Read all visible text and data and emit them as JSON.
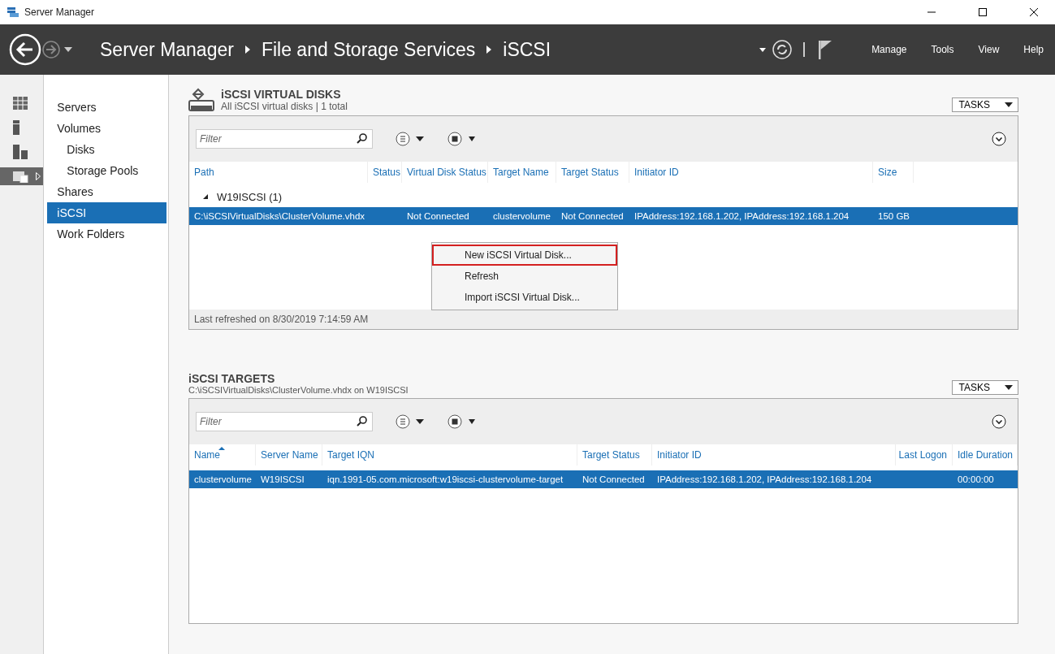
{
  "window": {
    "title": "Server Manager"
  },
  "breadcrumb": [
    "Server Manager",
    "File and Storage Services",
    "iSCSI"
  ],
  "header_menu": [
    "Manage",
    "Tools",
    "View",
    "Help"
  ],
  "rail": [
    {
      "kind": "dashboard",
      "selected": false
    },
    {
      "kind": "server",
      "selected": false
    },
    {
      "kind": "servers",
      "selected": false
    },
    {
      "kind": "storage",
      "selected": true
    }
  ],
  "nav": [
    {
      "label": "Servers",
      "selected": false
    },
    {
      "label": "Volumes",
      "selected": false,
      "children": [
        {
          "label": "Disks",
          "selected": false
        },
        {
          "label": "Storage Pools",
          "selected": false
        }
      ]
    },
    {
      "label": "Shares",
      "selected": false
    },
    {
      "label": "iSCSI",
      "selected": true
    },
    {
      "label": "Work Folders",
      "selected": false
    }
  ],
  "virtual_disks": {
    "title": "iSCSI VIRTUAL DISKS",
    "subtitle": "All iSCSI virtual disks | 1 total",
    "tasks": "TASKS",
    "filter": {
      "placeholder": "Filter"
    },
    "columns": [
      "Path",
      "Status",
      "Virtual Disk Status",
      "Target Name",
      "Target Status",
      "Initiator ID",
      "Size"
    ],
    "group": {
      "label": "W19ISCSI (1)",
      "expanded": true
    },
    "rows": [
      {
        "selected": true,
        "cells": [
          "C:\\iSCSIVirtualDisks\\ClusterVolume.vhdx",
          null,
          "Not Connected",
          "clustervolume",
          "Not Connected",
          "IPAddress:192.168.1.202, IPAddress:192.168.1.204",
          "150 GB"
        ]
      }
    ],
    "context_menu": [
      {
        "label": "New iSCSI Virtual Disk...",
        "selected": true
      },
      {
        "label": "Refresh",
        "selected": false
      },
      {
        "label": "Import iSCSI Virtual Disk...",
        "selected": false
      }
    ],
    "footer": "Last refreshed on 8/30/2019 7:14:59 AM"
  },
  "targets": {
    "title": "iSCSI TARGETS",
    "subtitle": "C:\\iSCSIVirtualDisks\\ClusterVolume.vhdx on W19ISCSI",
    "tasks": "TASKS",
    "filter": {
      "placeholder": "Filter"
    },
    "columns": [
      {
        "label": "Name",
        "sorted": true
      },
      {
        "label": "Server Name",
        "sorted": false
      },
      {
        "label": "Target IQN",
        "sorted": false
      },
      {
        "label": "Target Status",
        "sorted": false
      },
      {
        "label": "Initiator ID",
        "sorted": false
      },
      {
        "label": "Last Logon",
        "sorted": false
      },
      {
        "label": "Idle Duration",
        "sorted": false
      }
    ],
    "rows": [
      {
        "selected": true,
        "cells": [
          "clustervolume",
          "W19ISCSI",
          "iqn.1991-05.com.microsoft:w19iscsi-clustervolume-target",
          "Not Connected",
          "IPAddress:192.168.1.202, IPAddress:192.168.1.204",
          null,
          "00:00:00"
        ]
      }
    ]
  }
}
